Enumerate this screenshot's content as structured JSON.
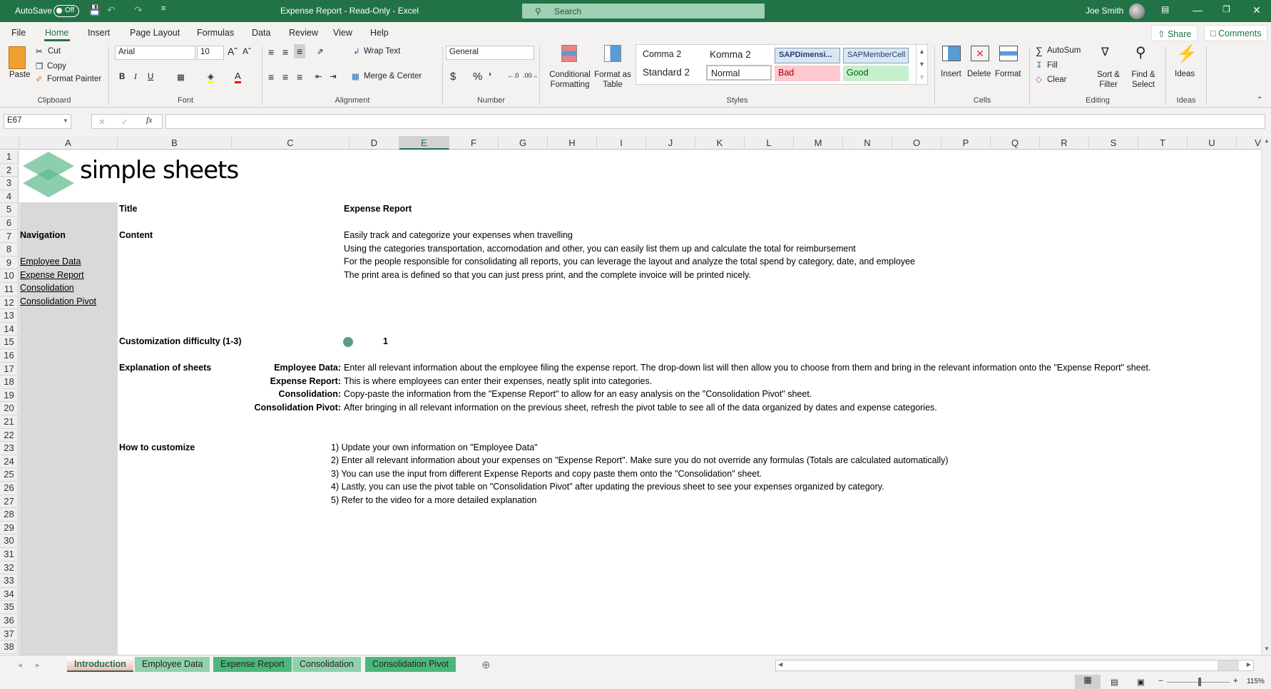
{
  "titlebar": {
    "autosave_label": "AutoSave",
    "autosave_state": "Off",
    "window_title": "Expense Report  -  Read-Only  -  Excel",
    "search_placeholder": "Search",
    "user_name": "Joe Smith"
  },
  "menu": {
    "tabs": [
      "File",
      "Home",
      "Insert",
      "Page Layout",
      "Formulas",
      "Data",
      "Review",
      "View",
      "Help"
    ],
    "active": "Home",
    "share_label": "Share",
    "comments_label": "Comments"
  },
  "ribbon": {
    "clipboard": {
      "paste": "Paste",
      "cut": "Cut",
      "copy": "Copy",
      "format_painter": "Format Painter",
      "label": "Clipboard"
    },
    "font": {
      "family": "Arial",
      "size": "10",
      "bold": "B",
      "italic": "I",
      "underline": "U",
      "label": "Font",
      "fill_color": "#ffff00",
      "font_color": "#ff0000"
    },
    "alignment": {
      "wrap_text": "Wrap Text",
      "merge_center": "Merge & Center",
      "label": "Alignment"
    },
    "number": {
      "format": "General",
      "currency": "$",
      "percent": "%",
      "comma": "9",
      "label": "Number"
    },
    "styles": {
      "conditional_formatting": "Conditional Formatting",
      "format_as_table": "Format as Table",
      "cells": [
        {
          "name": "Comma 2"
        },
        {
          "name": "Komma 2"
        },
        {
          "name": "SAPDimensi..."
        },
        {
          "name": "SAPMemberCell"
        },
        {
          "name": "Standard 2"
        },
        {
          "name": "Normal"
        },
        {
          "name": "Bad"
        },
        {
          "name": "Good"
        }
      ],
      "label": "Styles"
    },
    "cells": {
      "insert": "Insert",
      "delete": "Delete",
      "format": "Format",
      "label": "Cells"
    },
    "editing": {
      "autosum": "AutoSum",
      "fill": "Fill",
      "clear": "Clear",
      "sort_filter": "Sort & Filter",
      "find_select": "Find & Select",
      "label": "Editing"
    },
    "ideas": {
      "ideas": "Ideas",
      "label": "Ideas"
    }
  },
  "formula_bar": {
    "name_box": "E67",
    "fx": "fx",
    "formula": ""
  },
  "grid": {
    "columns": [
      "A",
      "B",
      "C",
      "D",
      "E",
      "F",
      "G",
      "H",
      "I",
      "J",
      "K",
      "L",
      "M",
      "N",
      "O",
      "P",
      "Q",
      "R",
      "S",
      "T",
      "U",
      "V"
    ],
    "selected_column": "E",
    "rows": [
      "1",
      "2",
      "3",
      "4",
      "5",
      "6",
      "7",
      "8",
      "9",
      "10",
      "11",
      "12",
      "13",
      "14",
      "15",
      "16",
      "17",
      "18",
      "19",
      "20",
      "21",
      "22",
      "23",
      "24",
      "25",
      "26",
      "27",
      "28",
      "29",
      "30",
      "31",
      "32",
      "33",
      "34",
      "35",
      "36",
      "37",
      "38"
    ]
  },
  "logo": {
    "text": "simple sheets"
  },
  "content": {
    "title_label": "Title",
    "title_value": "Expense Report",
    "navigation_label": "Navigation",
    "nav_links": [
      "Employee Data",
      "Expense Report",
      "Consolidation",
      "Consolidation Pivot"
    ],
    "content_label": "Content",
    "content_lines": [
      "Easily track and categorize your expenses when travelling",
      "Using the categories transportation, accomodation and other, you can easily list them up and calculate the total for reimbursement",
      "For the people responsible for consolidating all reports, you can leverage the layout and analyze the total spend by category, date, and employee",
      "The print area is defined so that you can just press print, and the complete invoice will be printed nicely."
    ],
    "difficulty_label": "Customization difficulty (1-3)",
    "difficulty_value": "1",
    "difficulty_color": "#5a9e80",
    "explanation_label": "Explanation of sheets",
    "explanations": [
      {
        "sheet": "Employee Data:",
        "text": "Enter all relevant information about the employee filing the expense report. The drop-down list will then allow you to choose from them and bring in the relevant information onto the \"Expense Report\" sheet."
      },
      {
        "sheet": "Expense Report:",
        "text": "This is where employees can enter their expenses, neatly split into categories."
      },
      {
        "sheet": "Consolidation:",
        "text": "Copy-paste the information from the \"Expense Report\" to allow for an easy analysis on the \"Consolidation Pivot\" sheet."
      },
      {
        "sheet": "Consolidation Pivot:",
        "text": "After bringing in all relevant information on the previous sheet, refresh the pivot table to see all of the data organized by dates and expense categories."
      }
    ],
    "customize_label": "How to customize",
    "customize_steps": [
      "1) Update your own information on \"Employee Data\"",
      "2) Enter all relevant information about your expenses on \"Expense Report\". Make sure you do not override any formulas (Totals are calculated automatically)",
      "3) You can use the input from different Expense Reports and copy paste them onto the \"Consolidation\" sheet.",
      "4) Lastly, you can use the pivot table on \"Consolidation Pivot\" after updating the previous sheet to see your expenses organized by category.",
      "5) Refer to the video for a more detailed explanation"
    ]
  },
  "sheets": {
    "tabs": [
      {
        "label": "Introduction",
        "color": "#f4b6b6",
        "active": true
      },
      {
        "label": "Employee Data",
        "color": "#8fd1aa"
      },
      {
        "label": "Expense Report",
        "color": "#4cb77b"
      },
      {
        "label": "Consolidation",
        "color": "#8fd1aa"
      },
      {
        "label": "Consolidation Pivot",
        "color": "#4cb77b"
      }
    ]
  },
  "status": {
    "zoom": "115%"
  }
}
